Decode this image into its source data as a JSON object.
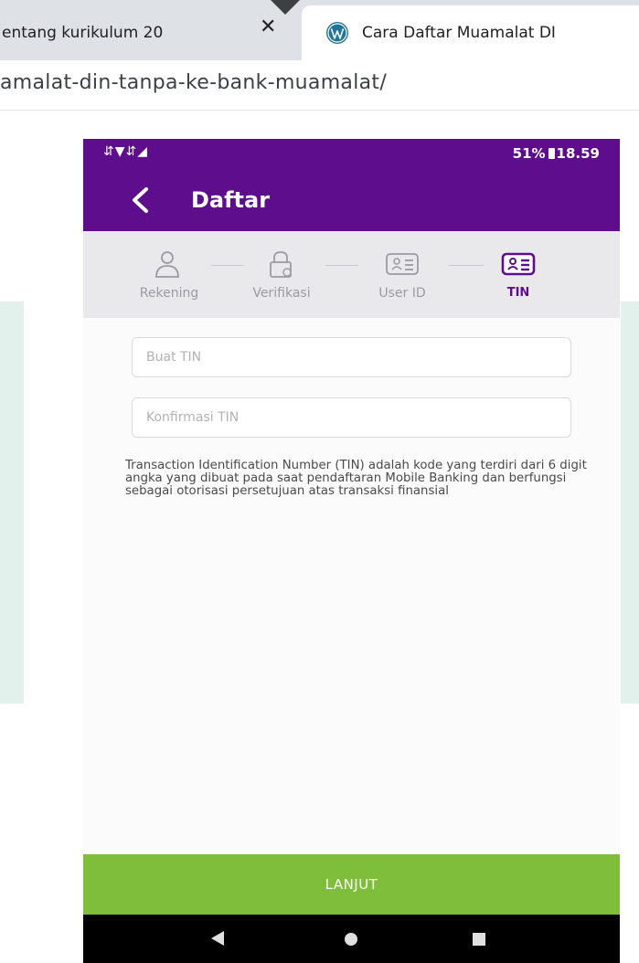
{
  "browser": {
    "tabs": [
      {
        "title": "entang kurikulum 20",
        "close": "✕"
      },
      {
        "title": "Cara Daftar Muamalat DI"
      }
    ],
    "url": "amalat-din-tanpa-ke-bank-muamalat/"
  },
  "phone": {
    "status": {
      "battery": "51%",
      "time": "18.59"
    },
    "appbar": {
      "title": "Daftar"
    },
    "steps": [
      {
        "label": "Rekening",
        "icon": "person-icon"
      },
      {
        "label": "Verifikasi",
        "icon": "lock-icon"
      },
      {
        "label": "User ID",
        "icon": "id-card-icon"
      },
      {
        "label": "TIN",
        "icon": "id-card-icon",
        "active": true
      }
    ],
    "form": {
      "tin_placeholder": "Buat TIN",
      "confirm_placeholder": "Konfirmasi TIN",
      "info": "Transaction Identification Number (TIN) adalah kode yang terdiri dari 6 digit angka yang dibuat pada saat pendaftaran Mobile Banking dan berfungsi sebagai otorisasi persetujuan atas transaksi finansial"
    },
    "button": {
      "label": "LANJUT"
    }
  },
  "colors": {
    "brand_purple": "#5e0e8d",
    "button_green": "#7fbe3a",
    "stepper_bg": "#e9e9ec"
  }
}
